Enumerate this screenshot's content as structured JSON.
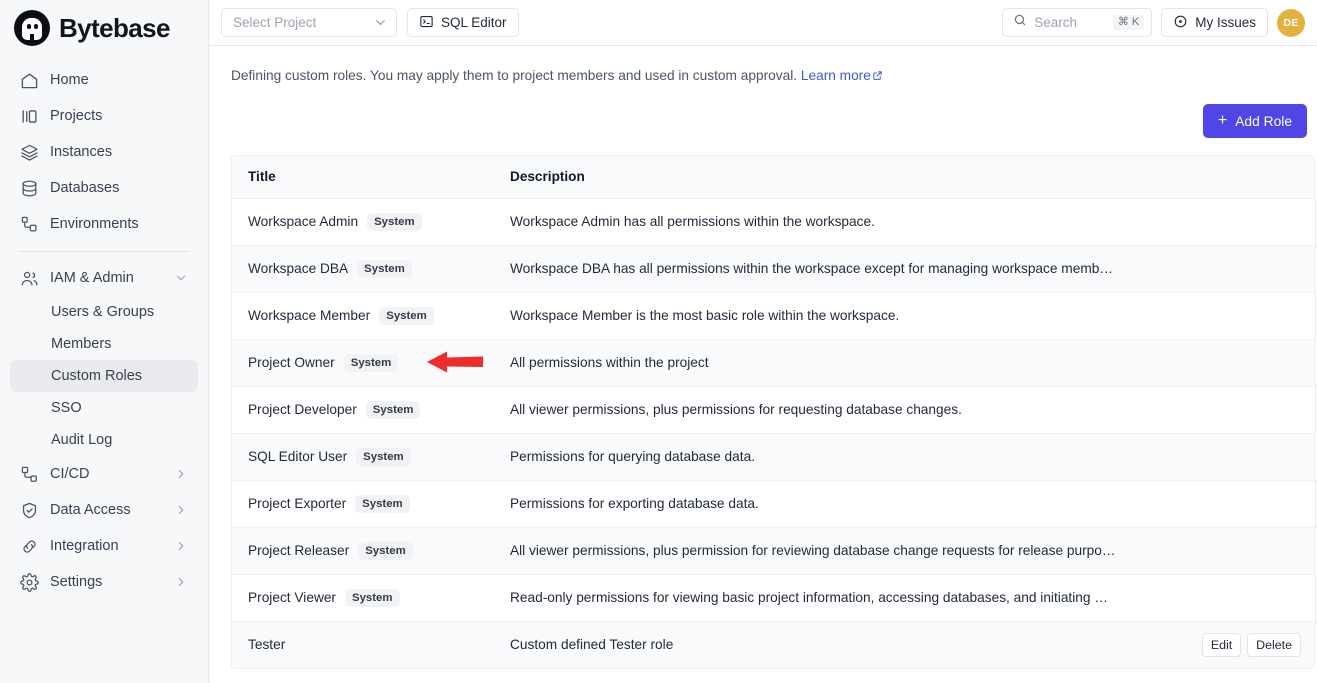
{
  "app": {
    "brand_name": "Bytebase"
  },
  "sidebar": {
    "items": [
      {
        "label": "Home",
        "icon": "home-icon"
      },
      {
        "label": "Projects",
        "icon": "projects-icon"
      },
      {
        "label": "Instances",
        "icon": "instances-icon"
      },
      {
        "label": "Databases",
        "icon": "databases-icon"
      },
      {
        "label": "Environments",
        "icon": "environments-icon"
      }
    ],
    "groups": [
      {
        "label": "IAM & Admin",
        "icon": "users-icon",
        "expanded": true,
        "children": [
          {
            "label": "Users & Groups",
            "active": false
          },
          {
            "label": "Members",
            "active": false
          },
          {
            "label": "Custom Roles",
            "active": true
          },
          {
            "label": "SSO",
            "active": false
          },
          {
            "label": "Audit Log",
            "active": false
          }
        ]
      },
      {
        "label": "CI/CD",
        "icon": "cicd-icon",
        "expanded": false
      },
      {
        "label": "Data Access",
        "icon": "shield-icon",
        "expanded": false
      },
      {
        "label": "Integration",
        "icon": "link-icon",
        "expanded": false
      },
      {
        "label": "Settings",
        "icon": "gear-icon",
        "expanded": false
      }
    ]
  },
  "topbar": {
    "project_select_placeholder": "Select Project",
    "sql_editor_label": "SQL Editor",
    "search_placeholder": "Search",
    "search_shortcut": "⌘ K",
    "my_issues_label": "My Issues",
    "avatar_initials": "DE"
  },
  "page": {
    "description": "Defining custom roles. You may apply them to project members and used in custom approval.",
    "learn_more_label": "Learn more",
    "add_role_label": "Add Role"
  },
  "table": {
    "columns": [
      "Title",
      "Description",
      ""
    ],
    "rows": [
      {
        "title": "Workspace Admin",
        "badge": "System",
        "description": "Workspace Admin has all permissions within the workspace.",
        "actions": []
      },
      {
        "title": "Workspace DBA",
        "badge": "System",
        "description": "Workspace DBA has all permissions within the workspace except for managing workspace memb…",
        "actions": []
      },
      {
        "title": "Workspace Member",
        "badge": "System",
        "description": "Workspace Member is the most basic role within the workspace.",
        "actions": []
      },
      {
        "title": "Project Owner",
        "badge": "System",
        "description": "All permissions within the project",
        "actions": []
      },
      {
        "title": "Project Developer",
        "badge": "System",
        "description": "All viewer permissions, plus permissions for requesting database changes.",
        "actions": []
      },
      {
        "title": "SQL Editor User",
        "badge": "System",
        "description": "Permissions for querying database data.",
        "actions": []
      },
      {
        "title": "Project Exporter",
        "badge": "System",
        "description": "Permissions for exporting database data.",
        "actions": []
      },
      {
        "title": "Project Releaser",
        "badge": "System",
        "description": "All viewer permissions, plus permission for reviewing database change requests for release purpo…",
        "actions": []
      },
      {
        "title": "Project Viewer",
        "badge": "System",
        "description": "Read-only permissions for viewing basic project information, accessing databases, and initiating …",
        "actions": []
      },
      {
        "title": "Tester",
        "badge": "",
        "description": "Custom defined Tester role",
        "actions": [
          "Edit",
          "Delete"
        ]
      }
    ]
  },
  "annotation": {
    "arrow_color": "#f02b2b",
    "points_at": "Workspace Member System badge"
  },
  "colors": {
    "accent": "#4f46e5",
    "link": "#3b5bdb",
    "sidebar_bg": "#f7f8f9",
    "avatar_bg": "#e3b23c",
    "badge_bg": "#f1f2f4"
  }
}
